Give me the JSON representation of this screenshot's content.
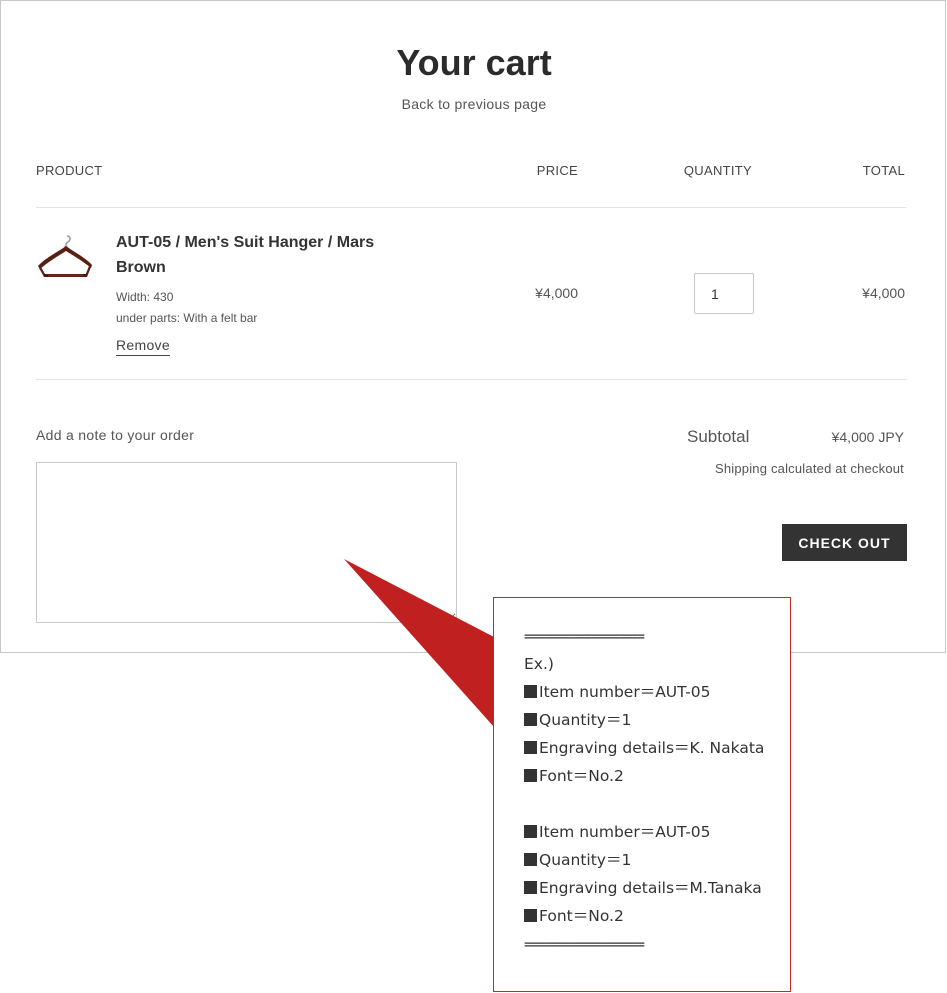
{
  "page": {
    "title": "Your cart",
    "back_link": "Back to previous page"
  },
  "columns": {
    "product": "PRODUCT",
    "price": "PRICE",
    "quantity": "QUANTITY",
    "total": "TOTAL"
  },
  "cart_item": {
    "name": "AUT-05 / Men's Suit Hanger / Mars Brown",
    "options": [
      "Width: 430",
      "under parts: With a felt bar"
    ],
    "remove_label": "Remove",
    "price": "¥4,000",
    "quantity": "1",
    "total": "¥4,000",
    "thumbnail_icon": "suit-hanger-icon"
  },
  "order_note": {
    "label": "Add a note to your order",
    "value": ""
  },
  "summary": {
    "subtotal_label": "Subtotal",
    "subtotal_value": "¥4,000 JPY",
    "shipping_note": "Shipping calculated at checkout",
    "checkout_label": "CHECK OUT"
  },
  "callout": {
    "separator": "=================",
    "example_label": "Ex.)",
    "lines": [
      "Item number＝AUT-05",
      "Quantity＝1",
      "Engraving details＝K. Nakata",
      "Font＝No.2",
      "Item number＝AUT-05",
      "Quantity＝1",
      "Engraving details＝M.Tanaka",
      "Font＝No.2"
    ],
    "bullet_icon": "black-square-icon",
    "border_color": "#c62828",
    "arrow_color": "#c0201f"
  }
}
